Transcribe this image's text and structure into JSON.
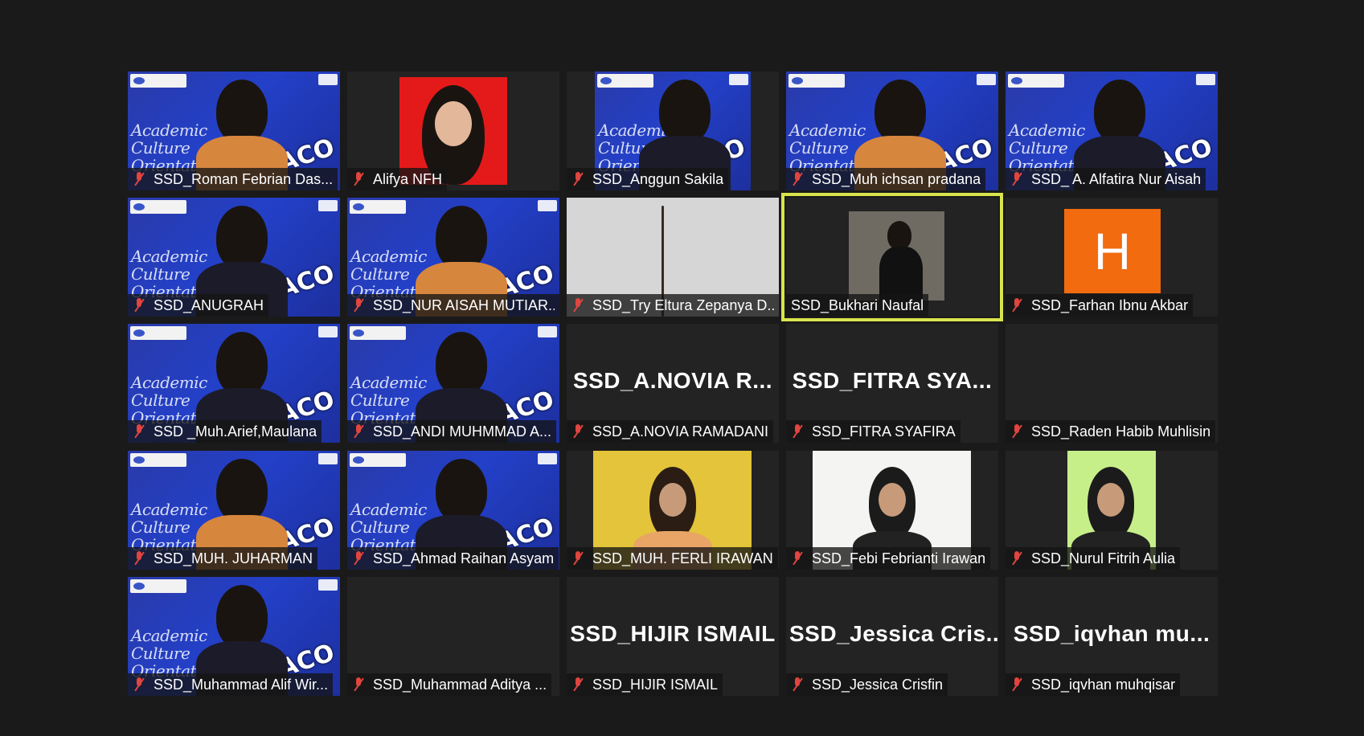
{
  "window": {
    "background": "#1a1a1a",
    "active_speaker_color": "#d9e44c"
  },
  "aco": {
    "line1": "Academic",
    "line2": "Culture",
    "line3": "Orientation",
    "logo": "ACO"
  },
  "tiles": [
    {
      "name": "SSD_Roman Febrian Das...",
      "muted": true,
      "video": "aco"
    },
    {
      "name": "Alifya NFH",
      "muted": true,
      "video": "photo-red"
    },
    {
      "name": "SSD_Anggun Sakila",
      "muted": true,
      "video": "aco-narrow"
    },
    {
      "name": "SSD_Muh ichsan pradana",
      "muted": true,
      "video": "aco"
    },
    {
      "name": "SSD_ A. Alfatira Nur Aisah",
      "muted": true,
      "video": "aco"
    },
    {
      "name": "SSD_ANUGRAH",
      "muted": true,
      "video": "aco"
    },
    {
      "name": "SSD_NUR AISAH MUTIAR...",
      "muted": true,
      "video": "aco"
    },
    {
      "name": "SSD_Try Eltura Zepanya D...",
      "muted": true,
      "video": "gray"
    },
    {
      "name": "SSD_Bukhari Naufal",
      "muted": false,
      "video": "cafe",
      "active": true
    },
    {
      "name": "SSD_Farhan Ibnu Akbar",
      "muted": true,
      "video": "avatar",
      "avatar_letter": "H",
      "avatar_color": "#f26b0f"
    },
    {
      "name": "SSD _Muh.Arief,Maulana",
      "muted": true,
      "video": "aco"
    },
    {
      "name": "SSD_ANDI MUHMMAD A...",
      "muted": true,
      "video": "aco"
    },
    {
      "name": "SSD_A.NOVIA RAMADANI",
      "muted": true,
      "video": "off",
      "big_name": "SSD_A.NOVIA R..."
    },
    {
      "name": "SSD_FITRA SYAFIRA",
      "muted": true,
      "video": "off",
      "big_name": "SSD_FITRA SYA..."
    },
    {
      "name": "SSD_Raden Habib Muhlisin",
      "muted": true,
      "video": "off",
      "big_name": ""
    },
    {
      "name": "SSD_MUH. JUHARMAN",
      "muted": true,
      "video": "aco"
    },
    {
      "name": "SSD_Ahmad Raihan Asyam",
      "muted": true,
      "video": "aco"
    },
    {
      "name": "SSD_MUH. FERLI IRAWAN",
      "muted": true,
      "video": "yellow"
    },
    {
      "name": "SSD_Febi Febrianti Irawan",
      "muted": true,
      "video": "white"
    },
    {
      "name": "SSD_Nurul Fitrih Aulia",
      "muted": true,
      "video": "green"
    },
    {
      "name": "SSD_Muhammad Alif Wir...",
      "muted": true,
      "video": "aco"
    },
    {
      "name": "SSD_Muhammad Aditya ...",
      "muted": true,
      "video": "off",
      "big_name": ""
    },
    {
      "name": "SSD_HIJIR ISMAIL",
      "muted": true,
      "video": "off",
      "big_name": "SSD_HIJIR ISMAIL"
    },
    {
      "name": "SSD_Jessica Crisfin",
      "muted": true,
      "video": "off",
      "big_name": "SSD_Jessica  Cris..."
    },
    {
      "name": "SSD_iqvhan muhqisar",
      "muted": true,
      "video": "off",
      "big_name": "SSD_iqvhan  mu..."
    }
  ]
}
